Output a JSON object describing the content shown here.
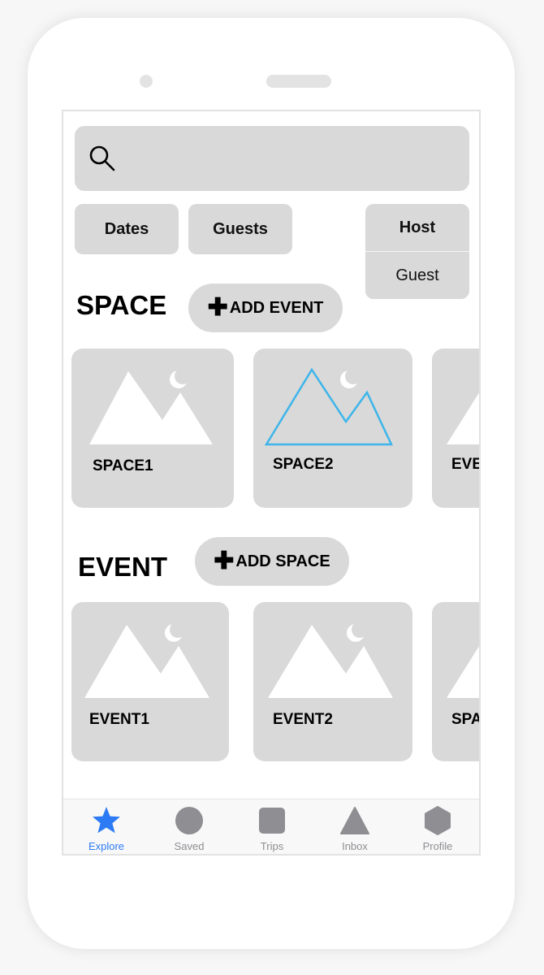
{
  "search": {
    "placeholder": ""
  },
  "filters": {
    "dates": "Dates",
    "guests": "Guests",
    "host": "Host",
    "guest": "Guest"
  },
  "space_section": {
    "title": "SPACE",
    "add_button": "ADD EVENT",
    "cards": [
      {
        "label": "SPACE1"
      },
      {
        "label": "SPACE2"
      },
      {
        "label": "EVE"
      }
    ]
  },
  "event_section": {
    "title": "EVENT",
    "add_button": "ADD SPACE",
    "cards": [
      {
        "label": "EVENT1"
      },
      {
        "label": "EVENT2"
      },
      {
        "label": "SPA"
      }
    ]
  },
  "tabs": [
    {
      "label": "Explore",
      "icon": "star-icon",
      "active": true
    },
    {
      "label": "Saved",
      "icon": "circle-icon",
      "active": false
    },
    {
      "label": "Trips",
      "icon": "square-icon",
      "active": false
    },
    {
      "label": "Inbox",
      "icon": "triangle-icon",
      "active": false
    },
    {
      "label": "Profile",
      "icon": "hexagon-icon",
      "active": false
    }
  ],
  "colors": {
    "placeholder_gray": "#d9d9d9",
    "active_tab": "#2d7bf4",
    "inactive_tab": "#8e8e93",
    "selected_outline": "#3db5ea"
  }
}
